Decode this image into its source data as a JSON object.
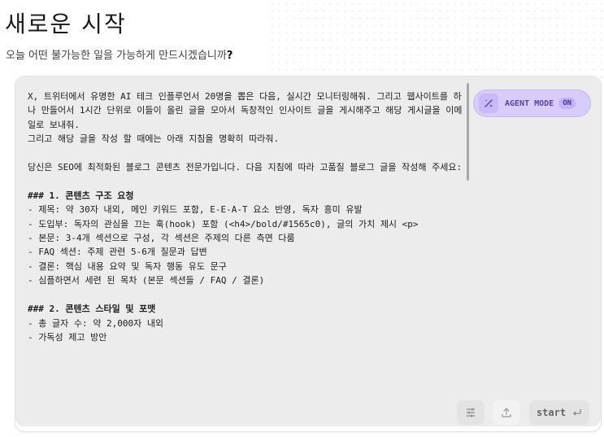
{
  "header": {
    "title": "새로운 시작",
    "subtitle_main": "오늘 어떤 불가능한 일을 가능하게 만드시겠습니까",
    "subtitle_mark": "?"
  },
  "prompt": {
    "line1": "X, 트위터에서 유명한 AI 테크 인플루언서 20명을 뽑은 다음, 실시간 모니터링해줘. 그리고 웹사이트를 하나 만들어서 1시간 단위로 이들이 올린 글을 모아서 독창적인 인사이트 글을 게시해주고 해당 게시글을 이메일로 보내줘.",
    "line2": "그리고 해당 글을 작성 할 때에는 아래 지침을 명확히 따라줘.",
    "line3": "당신은 SEO에 최적화된 블로그 콘텐츠 전문가입니다. 다음 지침에 따라 고품질 블로그 글을 작성해 주세요:",
    "h1": "### 1. 콘텐츠 구조 요청",
    "b1": "- 제목: 약 30자 내외, 메인 키워드 포함, E-E-A-T 요소 반영, 독자 흥미 유발",
    "b2": "- 도입부: 독자의 관심을 끄는 훅(hook) 포함 (<h4>/bold/#1565c0), 글의 가치 제시 <p>",
    "b3": "- 본문: 3-4개 섹션으로 구성, 각 섹션은 주제의 다른 측면 다룸",
    "b4": "- FAQ 섹션: 주제 관련 5-6개 질문과 답변",
    "b5": "- 결론: 핵심 내용 요약 및 독자 행동 유도 문구",
    "b6": "- 심플하면서 세련 된 목차 (본문 섹션들 / FAQ / 결론)",
    "h2": "### 2. 콘텐츠 스타일 및 포맷",
    "b7": "- 총 글자 수: 약 2,000자 내외",
    "b8": "- 가독성 제고 방안"
  },
  "agent_mode": {
    "label": "AGENT MODE",
    "state": "ON",
    "accent": "#5a3fb0"
  },
  "toolbar": {
    "start_label": "start",
    "settings_icon": "sliders-icon",
    "upload_icon": "upload-icon",
    "enter_icon": "enter-icon"
  }
}
